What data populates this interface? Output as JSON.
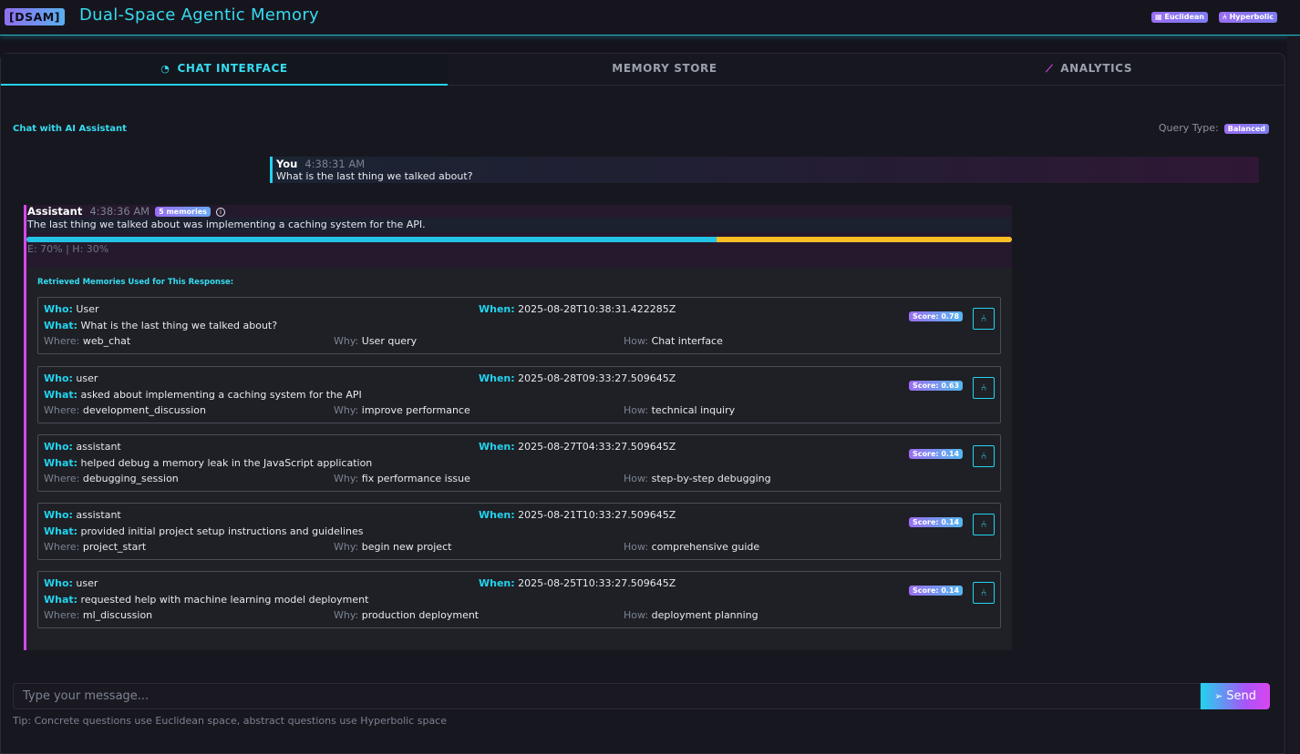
{
  "header": {
    "logo": "[DSAM]",
    "title": "Dual-Space Agentic Memory",
    "badges": [
      {
        "icon": "grid-icon",
        "label": "Euclidean"
      },
      {
        "icon": "hierarchy-icon",
        "label": "Hyperbolic"
      }
    ]
  },
  "tabs": [
    {
      "label": "CHAT INTERFACE",
      "icon": "chat-icon",
      "active": true
    },
    {
      "label": "MEMORY STORE",
      "active": false
    },
    {
      "label": "ANALYTICS",
      "icon": "chart-icon",
      "active": false
    }
  ],
  "chat": {
    "heading": "Chat with AI Assistant",
    "query_type_label": "Query Type:",
    "query_type_value": "Balanced",
    "messages": {
      "user": {
        "sender": "You",
        "time": "4:38:31 AM",
        "text": "What is the last thing we talked about?"
      },
      "assistant": {
        "sender": "Assistant",
        "time": "4:38:36 AM",
        "memories_badge": "5 memories",
        "text": "The last thing we talked about was implementing a caching system for the API.",
        "euclidean_ratio": 0.7,
        "ratio_label": "E: 70% | H: 30%",
        "retrieved_title": "Retrieved Memories Used for This Response:"
      }
    }
  },
  "labels": {
    "who": "Who:",
    "when": "When:",
    "what": "What:",
    "where": "Where:",
    "why": "Why:",
    "how": "How:"
  },
  "memories": [
    {
      "who": "User",
      "when": "2025-08-28T10:38:31.422285Z",
      "what": "What is the last thing we talked about?",
      "where": "web_chat",
      "why": "User query",
      "how": "Chat interface",
      "score": "Score: 0.78"
    },
    {
      "who": "user",
      "when": "2025-08-28T09:33:27.509645Z",
      "what": "asked about implementing a caching system for the API",
      "where": "development_discussion",
      "why": "improve performance",
      "how": "technical inquiry",
      "score": "Score: 0.63"
    },
    {
      "who": "assistant",
      "when": "2025-08-27T04:33:27.509645Z",
      "what": "helped debug a memory leak in the JavaScript application",
      "where": "debugging_session",
      "why": "fix performance issue",
      "how": "step-by-step debugging",
      "score": "Score: 0.14"
    },
    {
      "who": "assistant",
      "when": "2025-08-21T10:33:27.509645Z",
      "what": "provided initial project setup instructions and guidelines",
      "where": "project_start",
      "why": "begin new project",
      "how": "comprehensive guide",
      "score": "Score: 0.14"
    },
    {
      "who": "user",
      "when": "2025-08-25T10:33:27.509645Z",
      "what": "requested help with machine learning model deployment",
      "where": "ml_discussion",
      "why": "production deployment",
      "how": "deployment planning",
      "score": "Score: 0.14"
    }
  ],
  "composer": {
    "placeholder": "Type your message...",
    "send_label": "Send",
    "tip": "Tip: Concrete questions use Euclidean space, abstract questions use Hyperbolic space"
  },
  "colors": {
    "accent_cyan": "#22d3ee",
    "accent_magenta": "#d946ef",
    "accent_purple": "#9b6ef2",
    "hyperbolic_yellow": "#fbbf24",
    "background": "#15141d"
  }
}
